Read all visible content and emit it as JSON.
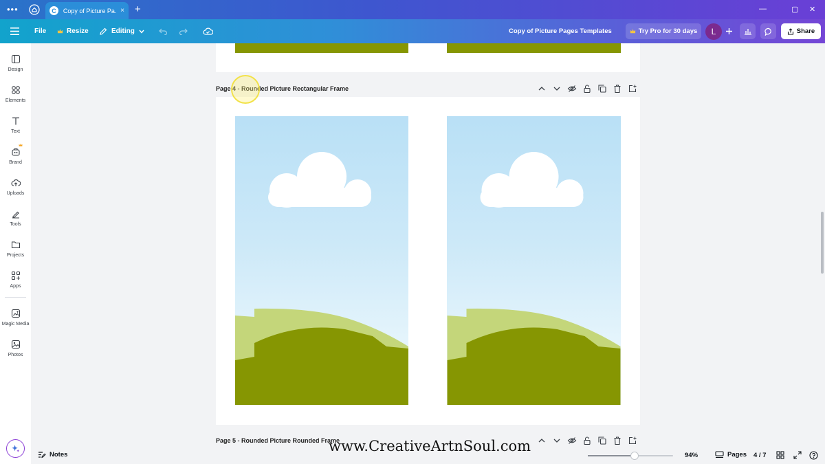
{
  "browser": {
    "tab_title": "Copy of Picture Pa...",
    "tab_favicon": "C",
    "new_tab": "+",
    "close": "×",
    "menu": "•••",
    "minimize": "—",
    "maximize": "▢",
    "close_window": "✕"
  },
  "toolbar": {
    "file_label": "File",
    "resize_label": "Resize",
    "editing_label": "Editing",
    "doc_title": "Copy of Picture Pages Templates",
    "try_pro_label": "Try Pro for 30 days",
    "avatar_initial": "L",
    "share_label": "Share"
  },
  "sidebar": {
    "items": [
      {
        "label": "Design",
        "icon": "design-icon"
      },
      {
        "label": "Elements",
        "icon": "elements-icon"
      },
      {
        "label": "Text",
        "icon": "text-icon"
      },
      {
        "label": "Brand",
        "icon": "brand-icon"
      },
      {
        "label": "Uploads",
        "icon": "uploads-icon"
      },
      {
        "label": "Tools",
        "icon": "tools-icon"
      },
      {
        "label": "Projects",
        "icon": "projects-icon"
      },
      {
        "label": "Apps",
        "icon": "apps-icon"
      },
      {
        "label": "Magic Media",
        "icon": "magic-media-icon"
      },
      {
        "label": "Photos",
        "icon": "photos-icon"
      }
    ]
  },
  "canvas": {
    "page4_label": "Page 4 - Rounded Picture Rectangular Frame",
    "page5_label": "Page 5 - Rounded Picture Rounded Frame"
  },
  "watermark": "www.CreativeArtnSoul.com",
  "bottom": {
    "notes_label": "Notes",
    "zoom_label": "94%",
    "zoom_fraction": 0.55,
    "pages_label": "Pages",
    "page_count": "4 / 7"
  },
  "colors": {
    "brand_accent": "#7446d6",
    "grass_dark": "#869602",
    "grass_light": "#c4d67a",
    "sky_top": "#b9e0f6"
  }
}
